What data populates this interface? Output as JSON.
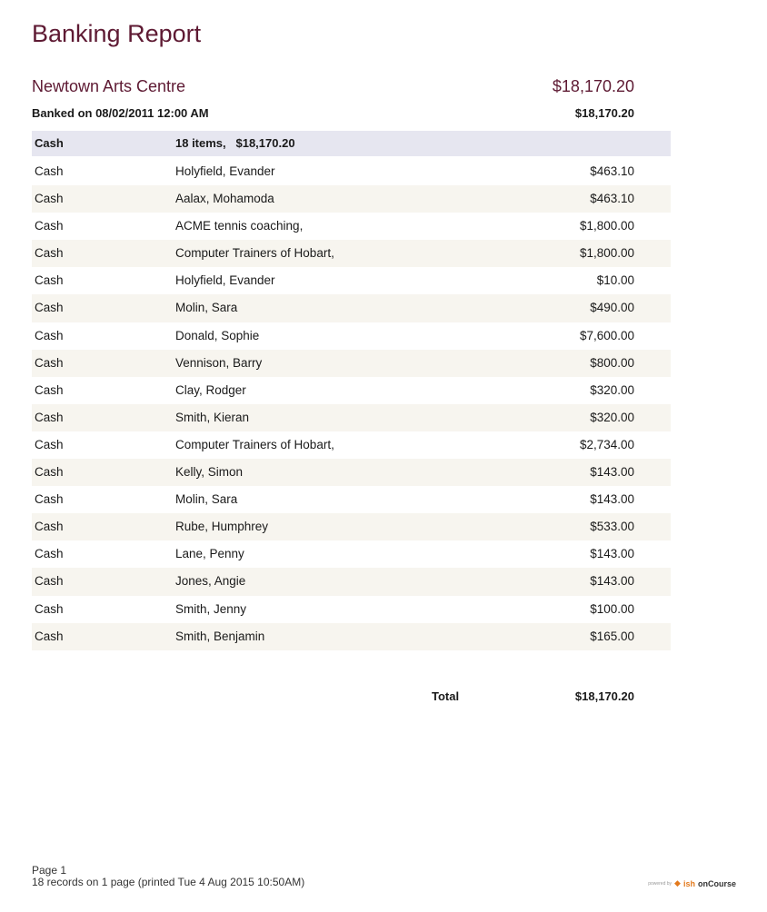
{
  "report": {
    "title": "Banking Report",
    "organisation": "Newtown Arts Centre",
    "organisation_total": "$18,170.20",
    "banked_label": "Banked on 08/02/2011 12:00 AM",
    "banked_amount": "$18,170.20"
  },
  "group": {
    "type": "Cash",
    "summary": "18 items,   $18,170.20"
  },
  "rows": [
    {
      "type": "Cash",
      "name": "Holyfield, Evander",
      "amount": "$463.10"
    },
    {
      "type": "Cash",
      "name": "Aalax, Mohamoda",
      "amount": "$463.10"
    },
    {
      "type": "Cash",
      "name": "ACME tennis coaching,",
      "amount": "$1,800.00"
    },
    {
      "type": "Cash",
      "name": "Computer Trainers of Hobart,",
      "amount": "$1,800.00"
    },
    {
      "type": "Cash",
      "name": "Holyfield, Evander",
      "amount": "$10.00"
    },
    {
      "type": "Cash",
      "name": "Molin, Sara",
      "amount": "$490.00"
    },
    {
      "type": "Cash",
      "name": "Donald, Sophie",
      "amount": "$7,600.00"
    },
    {
      "type": "Cash",
      "name": "Vennison, Barry",
      "amount": "$800.00"
    },
    {
      "type": "Cash",
      "name": "Clay, Rodger",
      "amount": "$320.00"
    },
    {
      "type": "Cash",
      "name": "Smith, Kieran",
      "amount": "$320.00"
    },
    {
      "type": "Cash",
      "name": "Computer Trainers of Hobart,",
      "amount": "$2,734.00"
    },
    {
      "type": "Cash",
      "name": "Kelly, Simon",
      "amount": "$143.00"
    },
    {
      "type": "Cash",
      "name": "Molin, Sara",
      "amount": "$143.00"
    },
    {
      "type": "Cash",
      "name": "Rube, Humphrey",
      "amount": "$533.00"
    },
    {
      "type": "Cash",
      "name": "Lane, Penny",
      "amount": "$143.00"
    },
    {
      "type": "Cash",
      "name": "Jones, Angie",
      "amount": "$143.00"
    },
    {
      "type": "Cash",
      "name": "Smith, Jenny",
      "amount": "$100.00"
    },
    {
      "type": "Cash",
      "name": "Smith, Benjamin",
      "amount": "$165.00"
    }
  ],
  "total": {
    "label": "Total",
    "amount": "$18,170.20"
  },
  "footer": {
    "page": "Page 1",
    "records": "18 records on 1 page (printed Tue 4 Aug 2015 10:50AM)"
  },
  "branding": {
    "powered_by": "powered by",
    "brand_a": "ish",
    "brand_b": "onCourse",
    "icon": "ish-logo-icon"
  }
}
